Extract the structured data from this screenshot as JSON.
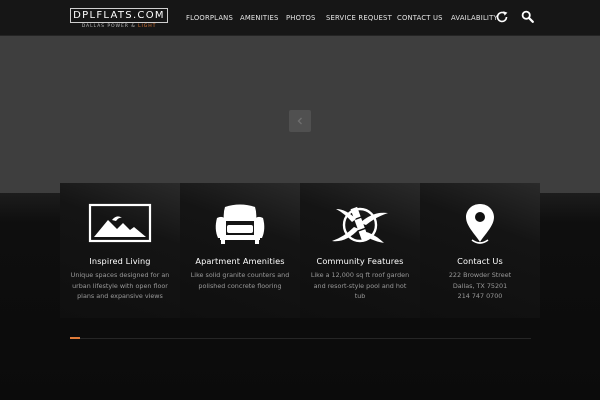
{
  "logo": {
    "name": "DPLFLATS.COM",
    "tagline_main": "DALLAS POWER & ",
    "tagline_accent": "LIGHT"
  },
  "nav": {
    "floorplans": "FLOORPLANS",
    "amenities": "AMENITIES",
    "photos": "PHOTOS",
    "service_request": "SERVICE REQUEST",
    "contact_us": "CONTACT US",
    "availability": "AVAILABILITY"
  },
  "icons": {
    "availability": "refresh-icon",
    "search": "search-icon",
    "slider": "chevron-left-icon"
  },
  "features": [
    {
      "icon": "mountain-landscape-icon",
      "title": "Inspired Living",
      "description": "Unique spaces designed for an urban lifestyle with open floor plans and expansive views"
    },
    {
      "icon": "armchair-icon",
      "title": "Apartment Amenities",
      "description": "Like solid granite counters and polished concrete flooring"
    },
    {
      "icon": "bamboo-leaf-icon",
      "title": "Community Features",
      "description": "Like a 12,000 sq ft roof garden and resort-style pool and hot tub"
    },
    {
      "icon": "map-pin-icon",
      "title": "Contact Us",
      "description": "222 Browder Street\nDallas, TX 75201\n214 747 0700"
    }
  ],
  "colors": {
    "accent": "#e07b39",
    "header_bg": "#161616",
    "hero_bg": "#3e3e3e",
    "page_bg": "#0b0b0b"
  }
}
